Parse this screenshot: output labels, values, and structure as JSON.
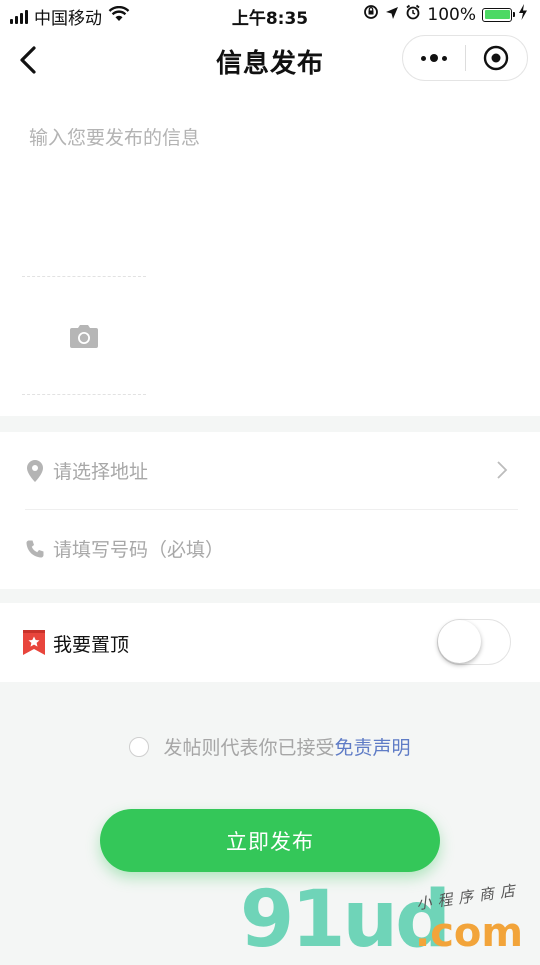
{
  "status_bar": {
    "carrier": "中国移动",
    "time": "上午8:35",
    "battery_percent": "100%",
    "battery_level": 1.0,
    "icons": [
      "signal-icon",
      "wifi-icon",
      "orientation-lock-icon",
      "location-icon",
      "alarm-icon",
      "battery-icon",
      "charging-icon"
    ]
  },
  "nav": {
    "title": "信息发布",
    "back_icon": "chevron-left-icon",
    "menu_icon": "more-dots-icon",
    "close_icon": "target-circle-icon"
  },
  "compose": {
    "placeholder": "输入您要发布的信息",
    "photo_icon": "camera-icon"
  },
  "address": {
    "placeholder": "请选择地址",
    "icon": "location-pin-icon",
    "chevron": "chevron-right-icon"
  },
  "phone": {
    "placeholder": "请填写号码（必填）",
    "icon": "phone-icon"
  },
  "pin_top": {
    "label": "我要置顶",
    "icon": "star-bookmark-icon",
    "enabled": false
  },
  "agreement": {
    "text": "发帖则代表你已接受",
    "link": "免责声明",
    "checked": false
  },
  "publish": {
    "label": "立即发布"
  },
  "watermark": {
    "main": "91ud",
    "domain": ".com",
    "tagline": "小程序商店"
  },
  "colors": {
    "accent": "#34c759",
    "link": "#5f7cc6",
    "pin_icon": "#e8453c",
    "battery": "#4cd964"
  }
}
